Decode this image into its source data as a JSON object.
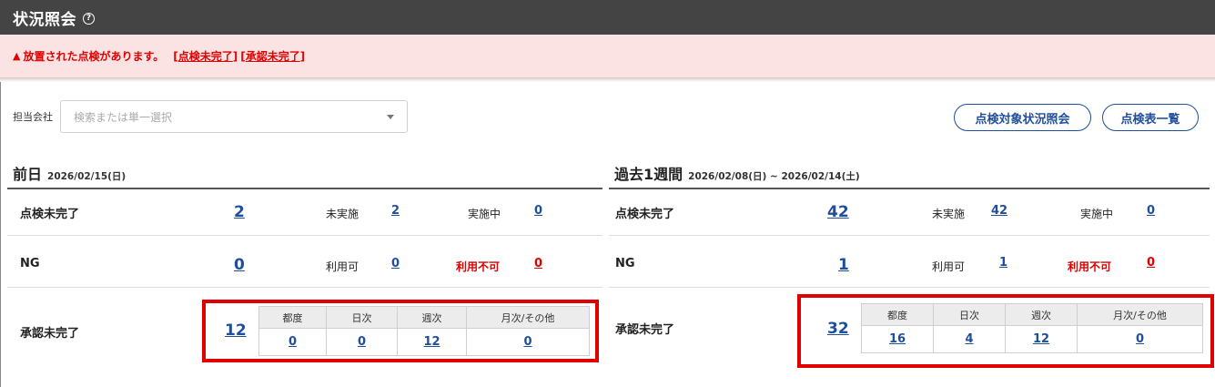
{
  "page": {
    "title": "状況照会",
    "help_icon": "?"
  },
  "alert": {
    "icon": "▲",
    "message": "放置された点検があります。",
    "link_incomplete": "点検未完了",
    "link_unapproved": "承認未完了"
  },
  "filter": {
    "label": "担当会社",
    "placeholder": "検索または単一選択"
  },
  "buttons": {
    "inspection_status": "点検対象状況照会",
    "checklist_list": "点検表一覧"
  },
  "colors": {
    "titlebar": "#444444",
    "alert_bg": "#fbe3e4",
    "alert_text": "#e00000",
    "link": "#1f4e9c",
    "highlight_box": "#e00000"
  },
  "yesterday": {
    "heading": "前日",
    "date": "2026/02/15(日)",
    "rows": {
      "incomplete": {
        "label": "点検未完了",
        "total": "2",
        "sub1_label": "未実施",
        "sub1_value": "2",
        "sub2_label": "実施中",
        "sub2_value": "0"
      },
      "ng": {
        "label": "NG",
        "total": "0",
        "sub1_label": "利用可",
        "sub1_value": "0",
        "sub2_label": "利用不可",
        "sub2_value": "0"
      },
      "unapproved": {
        "label": "承認未完了",
        "total": "12",
        "headers": [
          "都度",
          "日次",
          "週次",
          "月次/その他"
        ],
        "values": [
          "0",
          "0",
          "12",
          "0"
        ]
      }
    }
  },
  "week": {
    "heading": "過去1週間",
    "date": "2026/02/08(日) ~ 2026/02/14(土)",
    "rows": {
      "incomplete": {
        "label": "点検未完了",
        "total": "42",
        "sub1_label": "未実施",
        "sub1_value": "42",
        "sub2_label": "実施中",
        "sub2_value": "0"
      },
      "ng": {
        "label": "NG",
        "total": "1",
        "sub1_label": "利用可",
        "sub1_value": "1",
        "sub2_label": "利用不可",
        "sub2_value": "0"
      },
      "unapproved": {
        "label": "承認未完了",
        "total": "32",
        "headers": [
          "都度",
          "日次",
          "週次",
          "月次/その他"
        ],
        "values": [
          "16",
          "4",
          "12",
          "0"
        ]
      }
    }
  }
}
